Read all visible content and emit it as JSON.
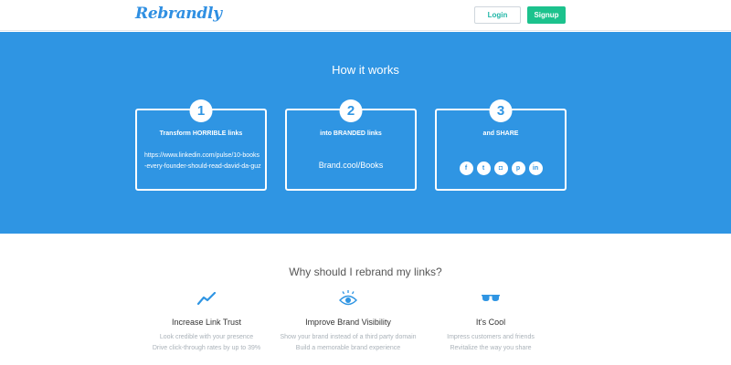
{
  "header": {
    "logo": "Rebrandly",
    "login_label": "Login",
    "signup_label": "Signup"
  },
  "hero": {
    "title": "How it works",
    "steps": [
      {
        "number": "1",
        "title": "Transform HORRIBLE links",
        "url": "https://www.linkedin.com/pulse/10-books-every-founder-should-read-david-da-guz"
      },
      {
        "number": "2",
        "title": "into BRANDED links",
        "brand_link": "Brand.cool/Books"
      },
      {
        "number": "3",
        "title": "and SHARE",
        "social": [
          {
            "name": "facebook-icon",
            "glyph": "f"
          },
          {
            "name": "twitter-icon",
            "glyph": "t"
          },
          {
            "name": "instagram-icon",
            "glyph": "◘"
          },
          {
            "name": "pinterest-icon",
            "glyph": "p"
          },
          {
            "name": "linkedin-icon",
            "glyph": "in"
          }
        ]
      }
    ]
  },
  "why": {
    "title": "Why should I rebrand my links?",
    "features": [
      {
        "title": "Increase Link Trust",
        "lines": [
          "Look credible with your presence",
          "Drive click-through rates by up to 39%"
        ]
      },
      {
        "title": "Improve Brand Visibility",
        "lines": [
          "Show your brand instead of a third party domain",
          "Build a memorable brand experience"
        ]
      },
      {
        "title": "It's Cool",
        "lines": [
          "Impress customers and friends",
          "Revitalize the way you share"
        ]
      }
    ]
  },
  "colors": {
    "brand_blue": "#2f95e3",
    "signup_green": "#1cc28d",
    "login_teal": "#20b6a6"
  }
}
